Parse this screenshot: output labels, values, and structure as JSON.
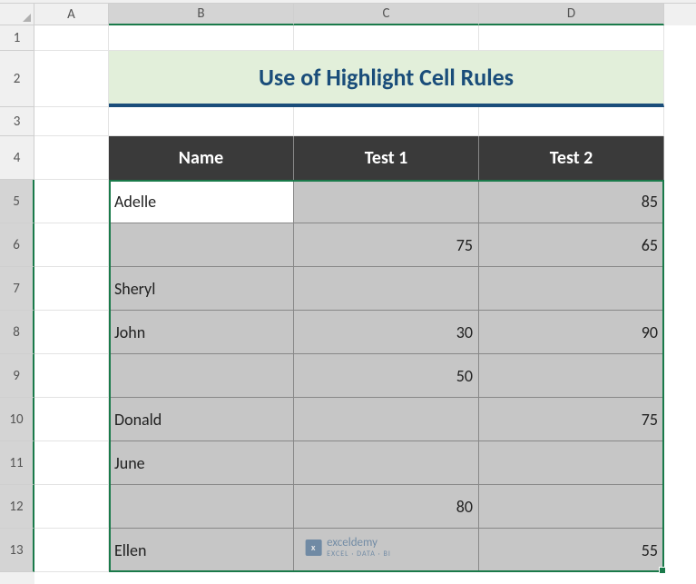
{
  "columns": {
    "A": "A",
    "B": "B",
    "C": "C",
    "D": "D"
  },
  "rows": [
    "1",
    "2",
    "3",
    "4",
    "5",
    "6",
    "7",
    "8",
    "9",
    "10",
    "11",
    "12",
    "13"
  ],
  "title": "Use of Highlight Cell Rules",
  "headers": {
    "name": "Name",
    "test1": "Test 1",
    "test2": "Test 2"
  },
  "data": [
    {
      "name": "Adelle",
      "t1": "",
      "t2": "85"
    },
    {
      "name": "",
      "t1": "75",
      "t2": "65"
    },
    {
      "name": "Sheryl",
      "t1": "",
      "t2": ""
    },
    {
      "name": "John",
      "t1": "30",
      "t2": "90"
    },
    {
      "name": "",
      "t1": "50",
      "t2": ""
    },
    {
      "name": "Donald",
      "t1": "",
      "t2": "75"
    },
    {
      "name": "June",
      "t1": "",
      "t2": ""
    },
    {
      "name": "",
      "t1": "80",
      "t2": ""
    },
    {
      "name": "Ellen",
      "t1": "",
      "t2": "55"
    }
  ],
  "watermark": {
    "brand": "exceldemy",
    "tagline": "EXCEL · DATA · BI"
  },
  "chart_data": {
    "type": "table",
    "title": "Use of Highlight Cell Rules",
    "columns": [
      "Name",
      "Test 1",
      "Test 2"
    ],
    "rows": [
      [
        "Adelle",
        null,
        85
      ],
      [
        null,
        75,
        65
      ],
      [
        "Sheryl",
        null,
        null
      ],
      [
        "John",
        30,
        90
      ],
      [
        null,
        50,
        null
      ],
      [
        "Donald",
        null,
        75
      ],
      [
        "June",
        null,
        null
      ],
      [
        null,
        80,
        null
      ],
      [
        "Ellen",
        null,
        55
      ]
    ]
  }
}
